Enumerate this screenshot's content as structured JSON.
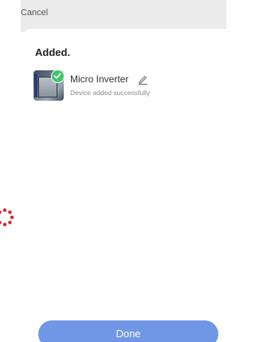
{
  "header": {
    "cancel_label": "Cancel"
  },
  "sheet": {
    "title": "Added."
  },
  "device": {
    "name": "Micro Inverter",
    "status": "Device added successfully",
    "icon": "edit-pencil-icon",
    "added_icon": "check-icon"
  },
  "footer": {
    "done_label": "Done"
  },
  "colors": {
    "accent": "#6f97e6",
    "success": "#3ec66a",
    "spinner": "#e0202a"
  }
}
